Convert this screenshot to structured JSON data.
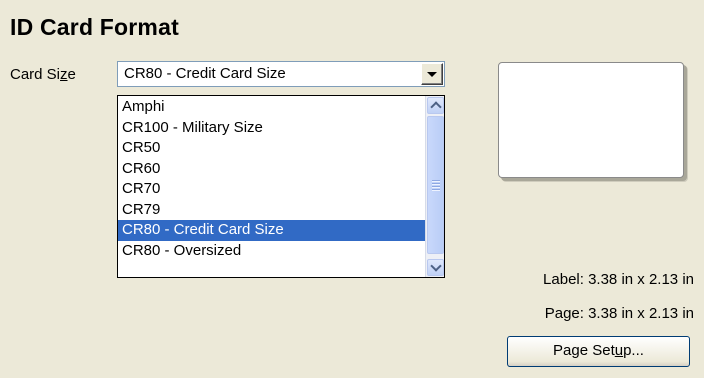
{
  "title": "ID Card Format",
  "card_size": {
    "label_prefix": "Card Si",
    "label_accel": "z",
    "label_suffix": "e",
    "selected_value": "CR80 - Credit Card Size",
    "options": [
      "Amphi",
      "CR100 - Military Size",
      "CR50",
      "CR60",
      "CR70",
      "CR79",
      "CR80 - Credit Card Size",
      "CR80 - Oversized"
    ],
    "selected_index": 6
  },
  "info": {
    "label_size": "Label: 3.38 in x 2.13 in",
    "page_size": "Page: 3.38 in x 2.13 in"
  },
  "page_setup": {
    "prefix": "Page Set",
    "accel": "u",
    "suffix": "p..."
  },
  "colors": {
    "window_bg": "#ece9d8",
    "selection": "#316ac5"
  }
}
